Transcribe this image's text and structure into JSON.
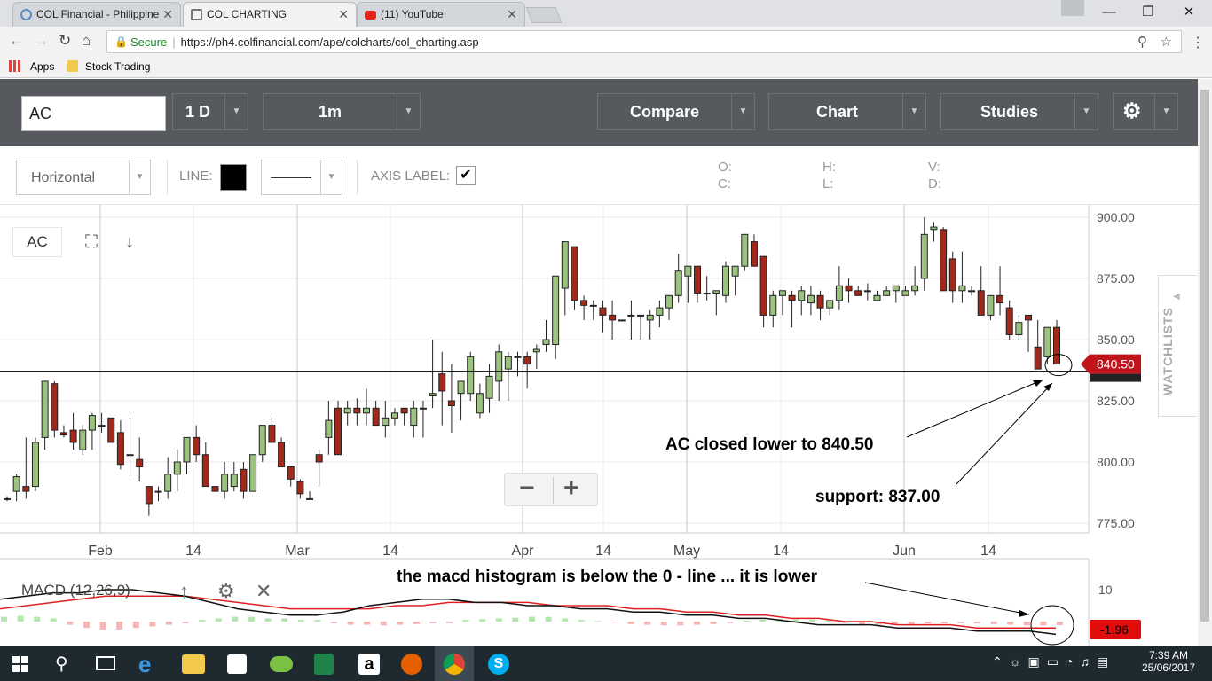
{
  "browser": {
    "tabs": [
      {
        "label": "COL Financial - Philippine Stock Trading",
        "active": false
      },
      {
        "label": "COL CHARTING",
        "active": true
      },
      {
        "label": "(11) YouTube",
        "active": false
      }
    ],
    "secure_label": "Secure",
    "url": "https://ph4.colfinancial.com/ape/colcharts/col_charting.asp",
    "bookmarks": [
      "Apps",
      "Stock Trading"
    ]
  },
  "toolbar": {
    "symbol_value": "AC",
    "period": "1 D",
    "interval": "1m",
    "compare_label": "Compare",
    "chart_label": "Chart",
    "studies_label": "Studies"
  },
  "drawing": {
    "tool": "Horizontal",
    "line_label": "LINE:",
    "axis_label": "AXIS LABEL:",
    "line_color": "#000000",
    "ohlc": {
      "o": "O:",
      "h": "H:",
      "l": "L:",
      "c": "C:",
      "v": "V:",
      "d": "D:"
    }
  },
  "chart": {
    "symbol_badge": "AC",
    "watchlists_label": "WATCHLISTS",
    "zoom_out": "−",
    "zoom_in": "+",
    "last_price_label": "840.50",
    "macd_label": "MACD (12,26,9)",
    "macd_value_label": "-1.96",
    "annotations": {
      "close": "AC closed lower to 840.50",
      "support": "support: 837.00",
      "macd": "the macd histogram is below the 0 - line ... it is lower"
    }
  },
  "chart_data": {
    "type": "candlestick",
    "ylim": [
      770,
      900
    ],
    "y_ticks": [
      "900.00",
      "875.00",
      "850.00",
      "825.00",
      "800.00",
      "775.00"
    ],
    "x_ticks": [
      "Feb",
      "14",
      "Mar",
      "14",
      "Apr",
      "14",
      "May",
      "14",
      "Jun",
      "14"
    ],
    "support_line": 837,
    "macd_ticks": [
      "10"
    ],
    "candles": [
      [
        785,
        786,
        784,
        785
      ],
      [
        788,
        795,
        784,
        794
      ],
      [
        790,
        810,
        785,
        788
      ],
      [
        790,
        810,
        788,
        808
      ],
      [
        810,
        830,
        805,
        833
      ],
      [
        832,
        833,
        810,
        813
      ],
      [
        812,
        815,
        810,
        811
      ],
      [
        813,
        820,
        805,
        808
      ],
      [
        805,
        815,
        803,
        813
      ],
      [
        813,
        820,
        805,
        819
      ],
      [
        815,
        820,
        812,
        815
      ],
      [
        818,
        818,
        808,
        808
      ],
      [
        812,
        817,
        797,
        799
      ],
      [
        803,
        818,
        794,
        803
      ],
      [
        801,
        810,
        792,
        798
      ],
      [
        790,
        790,
        778,
        783
      ],
      [
        788,
        790,
        784,
        788
      ],
      [
        788,
        802,
        785,
        795
      ],
      [
        795,
        805,
        788,
        800
      ],
      [
        800,
        810,
        795,
        810
      ],
      [
        810,
        815,
        800,
        803
      ],
      [
        803,
        808,
        790,
        790
      ],
      [
        790,
        790,
        788,
        788
      ],
      [
        788,
        800,
        785,
        795
      ],
      [
        790,
        800,
        788,
        795
      ],
      [
        797,
        800,
        785,
        788
      ],
      [
        788,
        803,
        788,
        803
      ],
      [
        803,
        815,
        800,
        815
      ],
      [
        815,
        820,
        808,
        808
      ],
      [
        808,
        810,
        798,
        798
      ],
      [
        798,
        798,
        790,
        793
      ],
      [
        792,
        793,
        785,
        787
      ],
      [
        785,
        788,
        785,
        785
      ],
      [
        803,
        805,
        790,
        800
      ],
      [
        810,
        825,
        803,
        817
      ],
      [
        822,
        825,
        803,
        803
      ],
      [
        820,
        825,
        815,
        822
      ],
      [
        822,
        826,
        815,
        820
      ],
      [
        820,
        830,
        815,
        822
      ],
      [
        822,
        825,
        815,
        815
      ],
      [
        815,
        825,
        810,
        818
      ],
      [
        818,
        822,
        815,
        820
      ],
      [
        822,
        822,
        815,
        820
      ],
      [
        815,
        825,
        810,
        822
      ],
      [
        822,
        825,
        810,
        822
      ],
      [
        827,
        850,
        822,
        828
      ],
      [
        836,
        845,
        815,
        829
      ],
      [
        825,
        840,
        812,
        823
      ],
      [
        828,
        832,
        817,
        833
      ],
      [
        828,
        845,
        825,
        843
      ],
      [
        820,
        832,
        818,
        828
      ],
      [
        826,
        840,
        820,
        835
      ],
      [
        833,
        848,
        825,
        845
      ],
      [
        838,
        845,
        825,
        843
      ],
      [
        843,
        845,
        835,
        843
      ],
      [
        843,
        845,
        830,
        840
      ],
      [
        845,
        848,
        838,
        846
      ],
      [
        848,
        858,
        845,
        850
      ],
      [
        848,
        876,
        842,
        876
      ],
      [
        871,
        890,
        860,
        890
      ],
      [
        888,
        888,
        862,
        866
      ],
      [
        866,
        868,
        858,
        864
      ],
      [
        864,
        866,
        858,
        864
      ],
      [
        863,
        866,
        853,
        860
      ],
      [
        860,
        866,
        850,
        858
      ],
      [
        858,
        858,
        858,
        858
      ],
      [
        860,
        866,
        850,
        860
      ],
      [
        860,
        860,
        850,
        860
      ],
      [
        858,
        862,
        850,
        860
      ],
      [
        860,
        866,
        855,
        863
      ],
      [
        863,
        868,
        858,
        868
      ],
      [
        868,
        885,
        865,
        878
      ],
      [
        876,
        880,
        865,
        880
      ],
      [
        880,
        880,
        865,
        869
      ],
      [
        869,
        876,
        866,
        869
      ],
      [
        869,
        870,
        860,
        870
      ],
      [
        868,
        882,
        865,
        880
      ],
      [
        876,
        880,
        868,
        880
      ],
      [
        880,
        890,
        878,
        893
      ],
      [
        890,
        893,
        880,
        880
      ],
      [
        884,
        884,
        855,
        860
      ],
      [
        860,
        870,
        855,
        868
      ],
      [
        868,
        870,
        860,
        870
      ],
      [
        868,
        870,
        855,
        866
      ],
      [
        866,
        872,
        860,
        870
      ],
      [
        865,
        872,
        860,
        868
      ],
      [
        868,
        870,
        858,
        863
      ],
      [
        863,
        866,
        860,
        866
      ],
      [
        866,
        880,
        862,
        872
      ],
      [
        872,
        875,
        865,
        870
      ],
      [
        870,
        872,
        868,
        868
      ],
      [
        870,
        873,
        866,
        870
      ],
      [
        866,
        870,
        866,
        868
      ],
      [
        868,
        872,
        868,
        870
      ],
      [
        870,
        872,
        865,
        872
      ],
      [
        868,
        872,
        868,
        870
      ],
      [
        870,
        880,
        868,
        872
      ],
      [
        875,
        900,
        870,
        893
      ],
      [
        895,
        898,
        890,
        896
      ],
      [
        895,
        896,
        870,
        870
      ],
      [
        883,
        886,
        865,
        870
      ],
      [
        870,
        886,
        865,
        872
      ],
      [
        870,
        872,
        868,
        870
      ],
      [
        870,
        880,
        860,
        860
      ],
      [
        860,
        868,
        858,
        868
      ],
      [
        868,
        880,
        860,
        865
      ],
      [
        863,
        866,
        850,
        852
      ],
      [
        852,
        860,
        850,
        857
      ],
      [
        860,
        860,
        845,
        858
      ],
      [
        847,
        858,
        838,
        838
      ],
      [
        843,
        855,
        840,
        855
      ],
      [
        855,
        858,
        840,
        840
      ]
    ],
    "macd_line": [
      7,
      8,
      9,
      9,
      10,
      10,
      9,
      8,
      6,
      4,
      3,
      2,
      2,
      3,
      5,
      6,
      7,
      7,
      6,
      6,
      5,
      5,
      4,
      4,
      3,
      3,
      2,
      2,
      1,
      1,
      0,
      -1,
      -1,
      -1,
      -2,
      -2,
      -2,
      -3,
      -3,
      -3,
      -4
    ],
    "signal_line": [
      4,
      5,
      6,
      7,
      8,
      8,
      8,
      8,
      7,
      6,
      5,
      4,
      4,
      4,
      4,
      5,
      5,
      6,
      6,
      6,
      6,
      5,
      5,
      5,
      4,
      4,
      3,
      3,
      2,
      2,
      1,
      1,
      0,
      0,
      -1,
      -1,
      -1,
      -2,
      -2,
      -2,
      -2
    ],
    "histogram": [
      1.5,
      1.8,
      1.5,
      1,
      -1,
      -2,
      -2.5,
      -2.5,
      -2,
      -1.5,
      -1,
      -0.5,
      0.5,
      1,
      1.5,
      1.5,
      1,
      1,
      0.5,
      0.5,
      -0.5,
      -1,
      -1,
      -1.2,
      -1,
      -0.8,
      -0.5,
      -0.5,
      0.5,
      0.8,
      1,
      1.2,
      1.5,
      1.5,
      1,
      0.5,
      0.2,
      -0.3,
      -0.8,
      -1,
      -1.2,
      -1.2,
      -1,
      -0.8,
      -0.5,
      0.3,
      0.6,
      0.8,
      0.7,
      0.6,
      0.5,
      -0.5,
      -0.8,
      -1,
      -1,
      -0.8,
      -0.6,
      -0.5,
      -0.5,
      -0.6,
      -0.8,
      -1,
      -1.2,
      -1.2,
      -1.1
    ]
  },
  "taskbar": {
    "time": "7:39 AM",
    "date": "25/06/2017"
  }
}
